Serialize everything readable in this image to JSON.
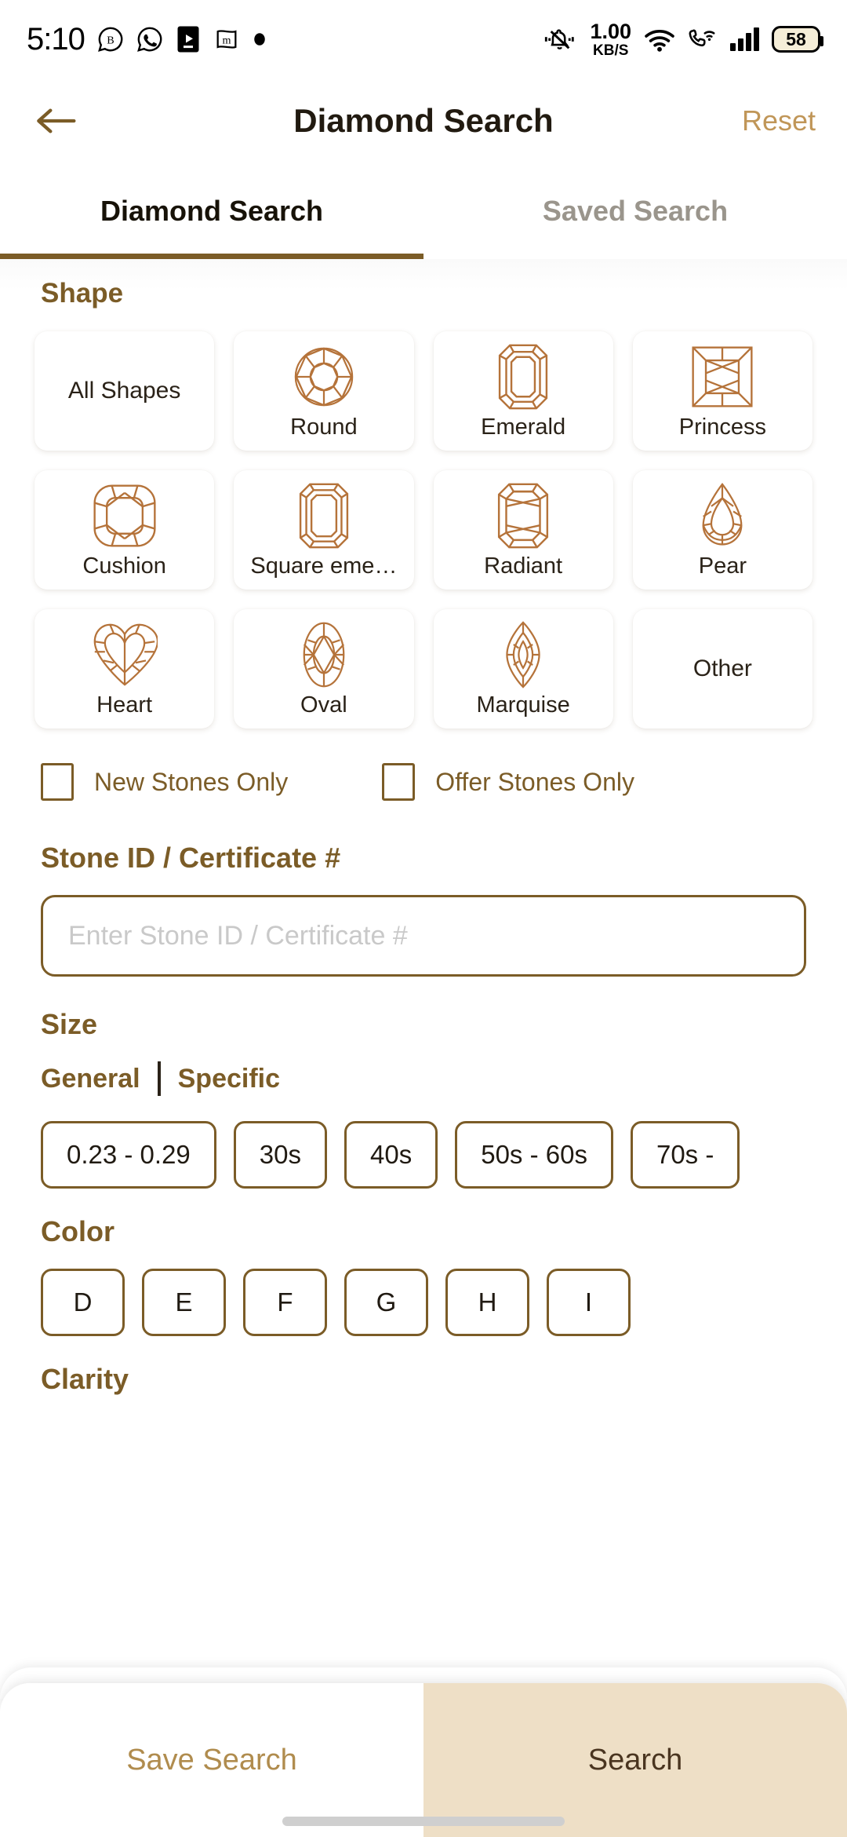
{
  "status_bar": {
    "time": "5:10",
    "left_icons": [
      "bubble-b-icon",
      "whatsapp-icon",
      "video-player-icon",
      "m-flag-icon",
      "dot-icon"
    ],
    "right_icons": [
      "silent-bell-icon",
      "wifi-icon",
      "call-wifi-icon",
      "signal-bars-icon"
    ],
    "net_speed_value": "1.00",
    "net_speed_unit": "KB/S",
    "battery_level": "58"
  },
  "app_bar": {
    "back_icon": "arrow-left-icon",
    "title": "Diamond Search",
    "reset_label": "Reset"
  },
  "tabs": [
    {
      "label": "Diamond Search",
      "active": true
    },
    {
      "label": "Saved Search",
      "active": false
    }
  ],
  "shape": {
    "title": "Shape",
    "items": [
      {
        "label": "All Shapes",
        "icon": "none"
      },
      {
        "label": "Round",
        "icon": "round-diamond-icon"
      },
      {
        "label": "Emerald",
        "icon": "emerald-diamond-icon"
      },
      {
        "label": "Princess",
        "icon": "princess-diamond-icon"
      },
      {
        "label": "Cushion",
        "icon": "cushion-diamond-icon"
      },
      {
        "label": "Square eme…",
        "icon": "square-emerald-diamond-icon"
      },
      {
        "label": "Radiant",
        "icon": "radiant-diamond-icon"
      },
      {
        "label": "Pear",
        "icon": "pear-diamond-icon"
      },
      {
        "label": "Heart",
        "icon": "heart-diamond-icon"
      },
      {
        "label": "Oval",
        "icon": "oval-diamond-icon"
      },
      {
        "label": "Marquise",
        "icon": "marquise-diamond-icon"
      },
      {
        "label": "Other",
        "icon": "none"
      }
    ]
  },
  "filters": {
    "new_stones_only": "New Stones Only",
    "offer_stones_only": "Offer Stones Only",
    "new_stones_checked": false,
    "offer_stones_checked": false
  },
  "stone_id": {
    "label": "Stone ID / Certificate #",
    "value": "",
    "placeholder": "Enter Stone ID / Certificate #"
  },
  "size": {
    "title": "Size",
    "mode_general": "General",
    "mode_specific": "Specific",
    "chips": [
      "0.23 - 0.29",
      "30s",
      "40s",
      "50s - 60s",
      "70s - "
    ]
  },
  "color": {
    "title": "Color",
    "chips": [
      "D",
      "E",
      "F",
      "G",
      "H",
      "I"
    ]
  },
  "clarity": {
    "title": "Clarity"
  },
  "bottom_bar": {
    "save_label": "Save Search",
    "search_label": "Search"
  },
  "colors": {
    "accent_brown": "#7b5c27",
    "accent_light": "#c09658",
    "diamond_icon": "#b5733a",
    "search_bg": "#eedfc6",
    "text_dark": "#211a10",
    "tab_inactive": "#9a958c"
  }
}
